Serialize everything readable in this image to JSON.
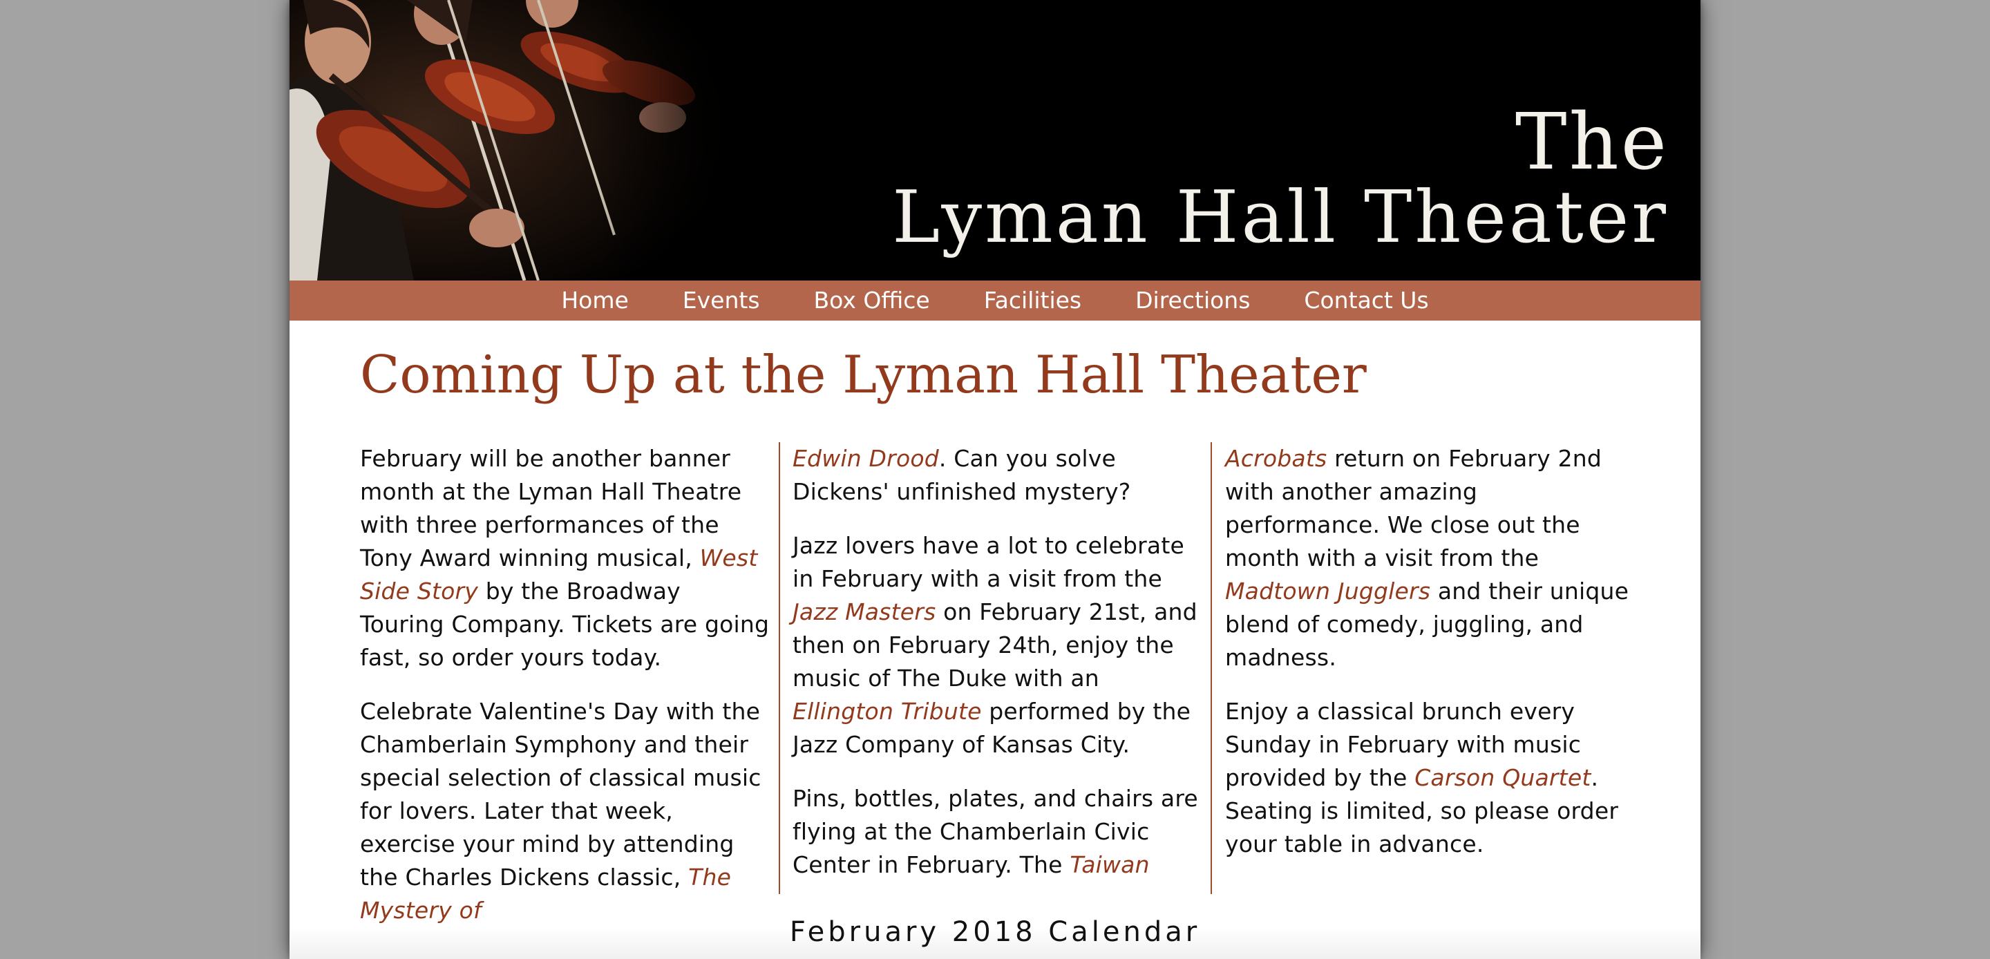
{
  "header": {
    "title_line1": "The",
    "title_line2": "Lyman Hall Theater",
    "photo_icon": "violinists-photo"
  },
  "nav": {
    "items": [
      {
        "label": "Home"
      },
      {
        "label": "Events"
      },
      {
        "label": "Box Office"
      },
      {
        "label": "Facilities"
      },
      {
        "label": "Directions"
      },
      {
        "label": "Contact Us"
      }
    ]
  },
  "main": {
    "heading": "Coming Up at the Lyman Hall Theater",
    "col1": {
      "p1_a": "February will be another banner month at the Lyman Hall Theatre with three performances of the Tony Award winning musical, ",
      "p1_link": "West Side Story",
      "p1_b": " by the Broadway Touring Company. Tickets are going fast, so order yours today.",
      "p2_a": "Celebrate Valentine's Day with the Chamberlain Symphony and their special selection of classical music for lovers. Later that week, exercise your mind by attending the Charles Dickens classic, ",
      "p2_link": "The Mystery of"
    },
    "col2": {
      "p1_link": "Edwin Drood",
      "p1_b": ". Can you solve Dickens' unfinished mystery?",
      "p2_a": "Jazz lovers have a lot to celebrate in February with a visit from the ",
      "p2_link1": "Jazz Masters",
      "p2_b": " on February 21st, and then on February 24th, enjoy the music of The Duke with an ",
      "p2_link2": "Ellington Tribute",
      "p2_c": " performed by the Jazz Company of Kansas City.",
      "p3_a": "Pins, bottles, plates, and chairs are flying at the Chamberlain Civic Center in February. The ",
      "p3_link": "Taiwan"
    },
    "col3": {
      "p1_link1": "Acrobats",
      "p1_a": " return on February 2nd with another amazing performance. We close out the month with a visit from the ",
      "p1_link2": "Madtown Jugglers",
      "p1_b": " and their unique blend of comedy, juggling, and madness.",
      "p2_a": "Enjoy a classical brunch every Sunday in February with music provided by the ",
      "p2_link": "Carson Quartet",
      "p2_b": ". Seating is limited, so please order your table in advance."
    },
    "calendar_caption": "February 2018 Calendar"
  },
  "colors": {
    "nav_bg": "#b3664b",
    "heading": "#93391c",
    "link": "#93391c",
    "column_rule": "#a14a2c",
    "page_bg": "#a3a3a3"
  }
}
